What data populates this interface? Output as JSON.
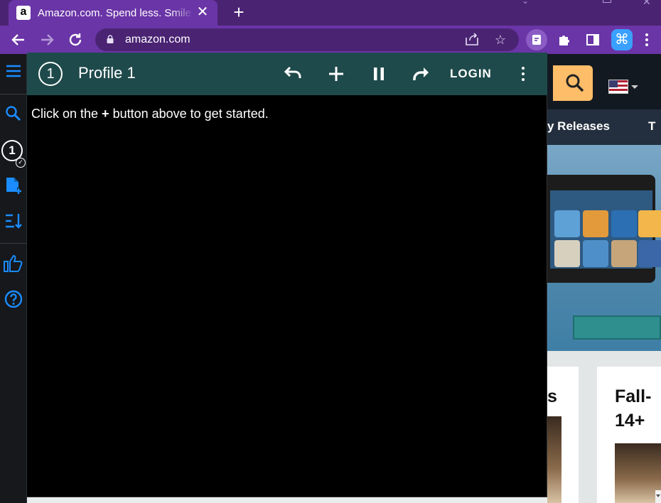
{
  "browser": {
    "tab_title": "Amazon.com. Spend less. Smile more.",
    "tab_favicon": "a",
    "url": "amazon.com",
    "new_tab_icon": "+",
    "close_icon": "✕"
  },
  "amazon": {
    "nav_item_1": "y Releases",
    "nav_item_2": "T",
    "card1_title": "s",
    "card2_title_line1": "Fall-",
    "card2_title_line2": "14+"
  },
  "extension": {
    "profile_number": "1",
    "profile_name": "Profile 1",
    "login_label": "LOGIN",
    "hint_prefix": "Click on the ",
    "hint_symbol": "+",
    "hint_suffix": " button above to get started.",
    "sidebar_badge": "1",
    "accent_color": "#1a8cff",
    "header_color": "#1f4a4b"
  }
}
